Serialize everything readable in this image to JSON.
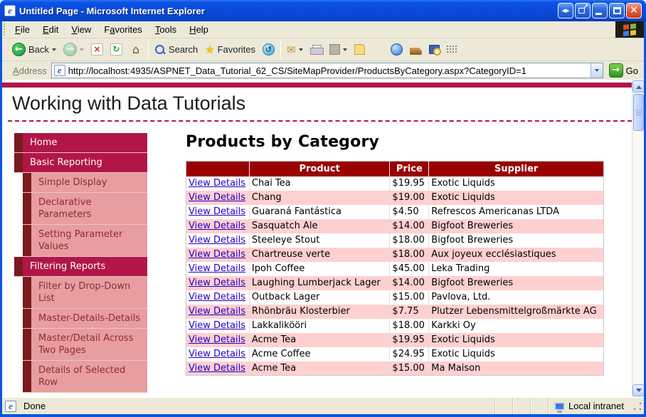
{
  "window": {
    "title": "Untitled Page - Microsoft Internet Explorer"
  },
  "menu": {
    "items": [
      {
        "label": "File",
        "accel": 0
      },
      {
        "label": "Edit",
        "accel": 0
      },
      {
        "label": "View",
        "accel": 0
      },
      {
        "label": "Favorites",
        "accel": 1
      },
      {
        "label": "Tools",
        "accel": 0
      },
      {
        "label": "Help",
        "accel": 0
      }
    ]
  },
  "toolbar": {
    "back_label": "Back",
    "search_label": "Search",
    "favorites_label": "Favorites"
  },
  "address_bar": {
    "label": "Address",
    "url": "http://localhost:4935/ASPNET_Data_Tutorial_62_CS/SiteMapProvider/ProductsByCategory.aspx?CategoryID=1",
    "go_label": "Go"
  },
  "icons": {
    "back_arrow": "←",
    "forward_arrow": "→",
    "stop_x": "×",
    "refresh": "↻",
    "home": "⌂",
    "favorites_star": "★",
    "history": "↺",
    "mail": "✉",
    "ie_e": "e",
    "close_x": "×",
    "arrows_lr": "◂▸",
    "popout_arrow": "↗",
    "go_arrow": "→"
  },
  "page": {
    "site_title": "Working with Data Tutorials",
    "heading": "Products by Category",
    "sidebar": [
      {
        "label": "Home",
        "level": 1
      },
      {
        "label": "Basic Reporting",
        "level": 1
      },
      {
        "label": "Simple Display",
        "level": 2
      },
      {
        "label": "Declarative Parameters",
        "level": 2
      },
      {
        "label": "Setting Parameter Values",
        "level": 2
      },
      {
        "label": "Filtering Reports",
        "level": 1
      },
      {
        "label": "Filter by Drop-Down List",
        "level": 2
      },
      {
        "label": "Master-Details-Details",
        "level": 2
      },
      {
        "label": "Master/Detail Across Two Pages",
        "level": 2
      },
      {
        "label": "Details of Selected Row",
        "level": 2
      }
    ],
    "table": {
      "link_label": "View Details",
      "headers": [
        "",
        "Product",
        "Price",
        "Supplier"
      ],
      "rows": [
        {
          "product": "Chai Tea",
          "price": "$19.95",
          "supplier": "Exotic Liquids"
        },
        {
          "product": "Chang",
          "price": "$19.00",
          "supplier": "Exotic Liquids"
        },
        {
          "product": "Guaraná Fantástica",
          "price": "$4.50",
          "supplier": "Refrescos Americanas LTDA"
        },
        {
          "product": "Sasquatch Ale",
          "price": "$14.00",
          "supplier": "Bigfoot Breweries"
        },
        {
          "product": "Steeleye Stout",
          "price": "$18.00",
          "supplier": "Bigfoot Breweries"
        },
        {
          "product": "Chartreuse verte",
          "price": "$18.00",
          "supplier": "Aux joyeux ecclésiastiques"
        },
        {
          "product": "Ipoh Coffee",
          "price": "$45.00",
          "supplier": "Leka Trading"
        },
        {
          "product": "Laughing Lumberjack Lager",
          "price": "$14.00",
          "supplier": "Bigfoot Breweries"
        },
        {
          "product": "Outback Lager",
          "price": "$15.00",
          "supplier": "Pavlova, Ltd."
        },
        {
          "product": "Rhönbräu Klosterbier",
          "price": "$7.75",
          "supplier": "Plutzer Lebensmittelgroßmärkte AG"
        },
        {
          "product": "Lakkalikööri",
          "price": "$18.00",
          "supplier": "Karkki Oy"
        },
        {
          "product": "Acme Tea",
          "price": "$19.95",
          "supplier": "Exotic Liquids"
        },
        {
          "product": "Acme Coffee",
          "price": "$24.95",
          "supplier": "Exotic Liquids"
        },
        {
          "product": "Acme Tea",
          "price": "$15.00",
          "supplier": "Ma Maison"
        }
      ]
    }
  },
  "status_bar": {
    "left": "Done",
    "zone": "Local intranet"
  },
  "colors": {
    "title_blue": "#0c55dd",
    "chrome": "#ece9d8",
    "crimson": "#b11646",
    "accent_dark": "#7a1a1f",
    "sub_pink": "#e89da1",
    "sub_text": "#8b2e34",
    "table_header_red": "#990000",
    "row_pink": "#ffd0d0",
    "link_blue": "#2200cc"
  }
}
